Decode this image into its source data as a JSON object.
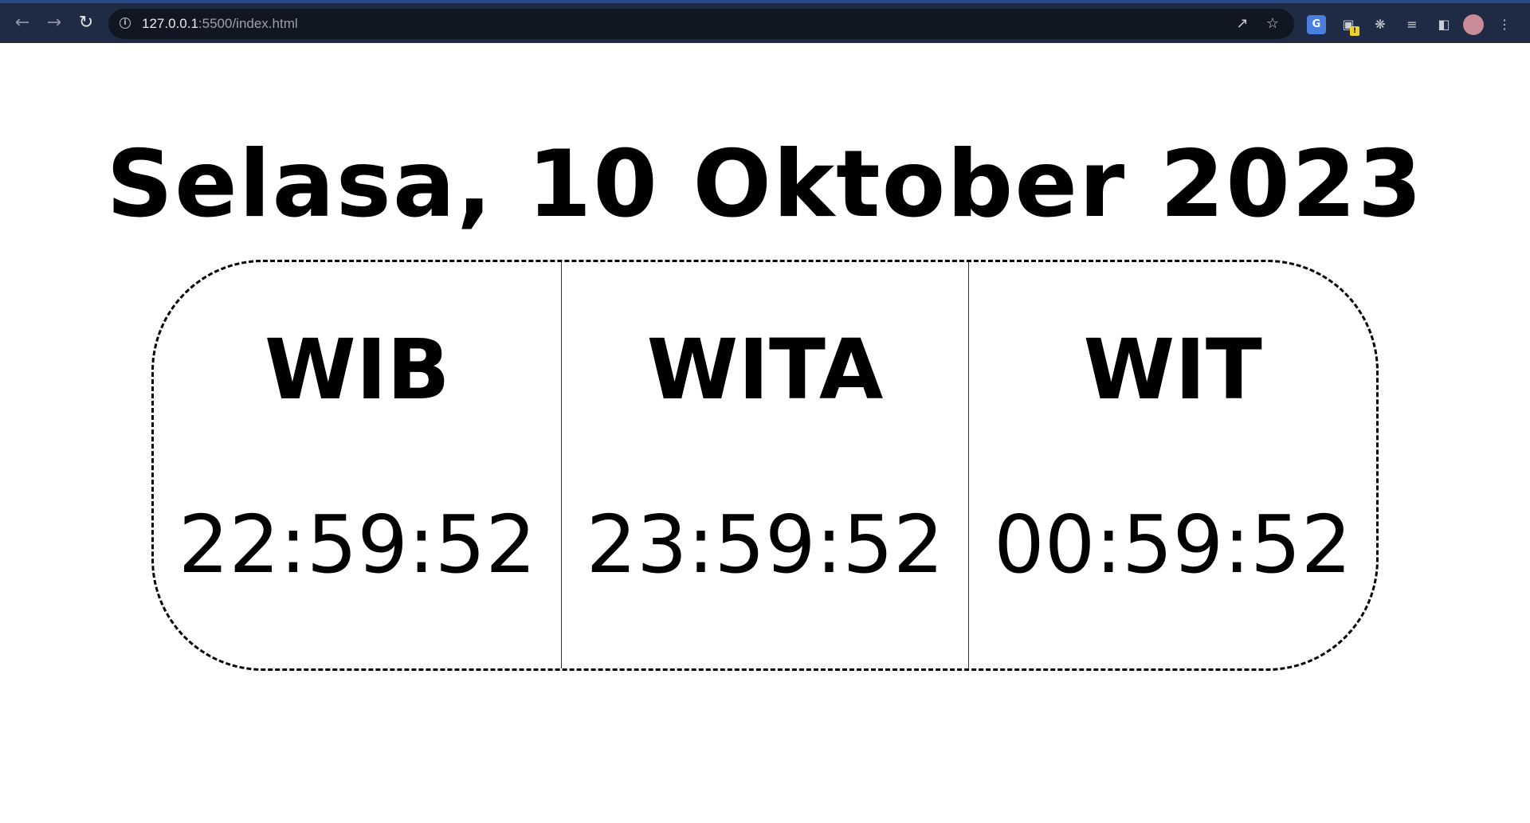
{
  "browser": {
    "url_host": "127.0.0.1",
    "url_rest": ":5500/index.html",
    "translate_label": "G",
    "badge_label": "!"
  },
  "page": {
    "title": "Selasa, 10 Oktober 2023",
    "zones": [
      {
        "name": "WIB",
        "time": "22:59:52"
      },
      {
        "name": "WITA",
        "time": "23:59:52"
      },
      {
        "name": "WIT",
        "time": "00:59:52"
      }
    ]
  }
}
